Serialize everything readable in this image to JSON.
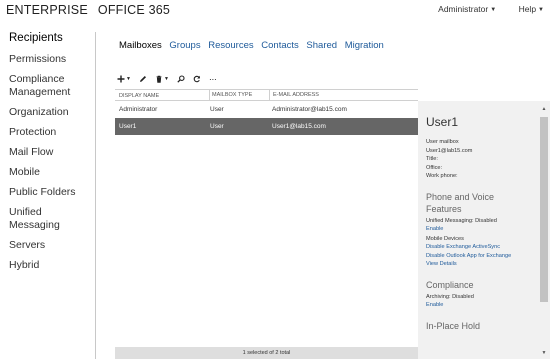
{
  "header": {
    "brand_left": "ENTERPRISE",
    "brand_right": "OFFICE 365",
    "user_label": "Administrator",
    "help_label": "Help"
  },
  "sidebar": {
    "items": [
      {
        "label": "Recipients",
        "active": true
      },
      {
        "label": "Permissions"
      },
      {
        "label": "Compliance\nManagement"
      },
      {
        "label": "Organization"
      },
      {
        "label": "Protection"
      },
      {
        "label": "Mail Flow"
      },
      {
        "label": "Mobile"
      },
      {
        "label": "Public Folders"
      },
      {
        "label": "Unified Messaging"
      },
      {
        "label": "Servers"
      },
      {
        "label": "Hybrid"
      }
    ]
  },
  "tabs": [
    {
      "label": "Mailboxes",
      "active": true
    },
    {
      "label": "Groups"
    },
    {
      "label": "Resources"
    },
    {
      "label": "Contacts"
    },
    {
      "label": "Shared"
    },
    {
      "label": "Migration"
    }
  ],
  "toolbar": {
    "icons": [
      "add-icon",
      "edit-icon",
      "delete-icon",
      "search-icon",
      "refresh-icon",
      "more-icon"
    ],
    "more_label": "···"
  },
  "table": {
    "columns": [
      "DISPLAY NAME",
      "MAILBOX TYPE",
      "E-MAIL ADDRESS"
    ],
    "rows": [
      {
        "name": "Administrator",
        "type": "User",
        "email": "Administrator@lab15.com",
        "selected": false
      },
      {
        "name": "User1",
        "type": "User",
        "email": "User1@lab15.com",
        "selected": true
      }
    ],
    "status": "1 selected of 2 total"
  },
  "details": {
    "title": "User1",
    "mailbox_type": "User mailbox",
    "email": "User1@lab15.com",
    "title_field": "Title:",
    "office_field": "Office:",
    "work_phone_field": "Work phone:",
    "phone_section": "Phone and Voice\nFeatures",
    "um_status": "Unified Messaging: Disabled",
    "um_enable": "Enable",
    "mobile_devices": "Mobile Devices",
    "disable_activesync": "Disable Exchange ActiveSync",
    "disable_owa": "Disable Outlook App for Exchange",
    "view_details": "View Details",
    "compliance_section": "Compliance",
    "archiving_status": "Archiving: Disabled",
    "archiving_enable": "Enable",
    "hold_section": "In-Place Hold"
  },
  "colors": {
    "selected_row": "#666666",
    "link": "#1e5a9a",
    "detail_bg": "#f1f1f1",
    "status_bg": "#dedede"
  }
}
